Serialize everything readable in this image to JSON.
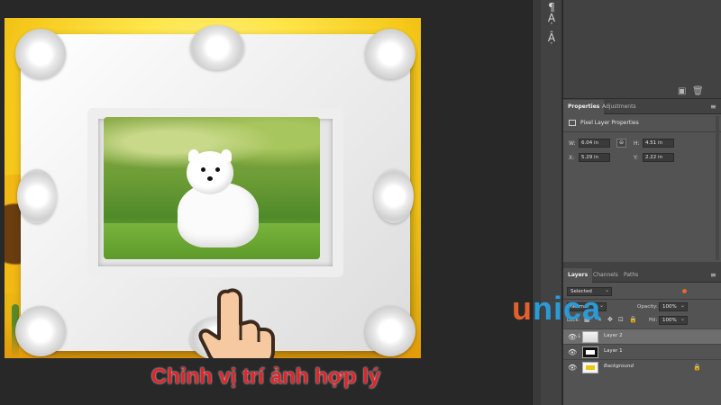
{
  "caption": "Chỉnh vị trí ảnh hợp lý",
  "watermark": {
    "first": "u",
    "rest": "nica"
  },
  "tool_column": {
    "icons": [
      "paragraph-icon",
      "character-style-icon",
      "glyph-icon"
    ],
    "glyphs": [
      "¶",
      "Ạ",
      "Ậ"
    ]
  },
  "properties_panel": {
    "tabs": [
      "Properties",
      "Adjustments"
    ],
    "heading": "Pixel Layer Properties",
    "w_label": "W:",
    "w_value": "6.04 in",
    "h_label": "H:",
    "h_value": "4.51 in",
    "x_label": "X:",
    "x_value": "5.29 in",
    "y_label": "Y:",
    "y_value": "2.22 in",
    "link_glyph": "⊖"
  },
  "layers_panel": {
    "tabs": [
      "Layers",
      "Channels",
      "Paths"
    ],
    "filter_value": "Selected",
    "blend_mode": "Normal",
    "opacity_label": "Opacity:",
    "opacity_value": "100%",
    "lock_label": "Lock:",
    "fill_label": "Fill:",
    "fill_value": "100%",
    "layers": [
      {
        "name": "Layer 2",
        "selected": true,
        "clipped": true
      },
      {
        "name": "Layer 1",
        "selected": false,
        "clipped": false
      },
      {
        "name": "Background",
        "selected": false,
        "clipped": false,
        "locked": true
      }
    ]
  },
  "colors": {
    "caption": "#e1242a",
    "watermark_u": "#e0612b",
    "watermark_rest": "#2a9bd7",
    "panel_bg": "#535353",
    "selected_layer": "#6e6e6e"
  }
}
